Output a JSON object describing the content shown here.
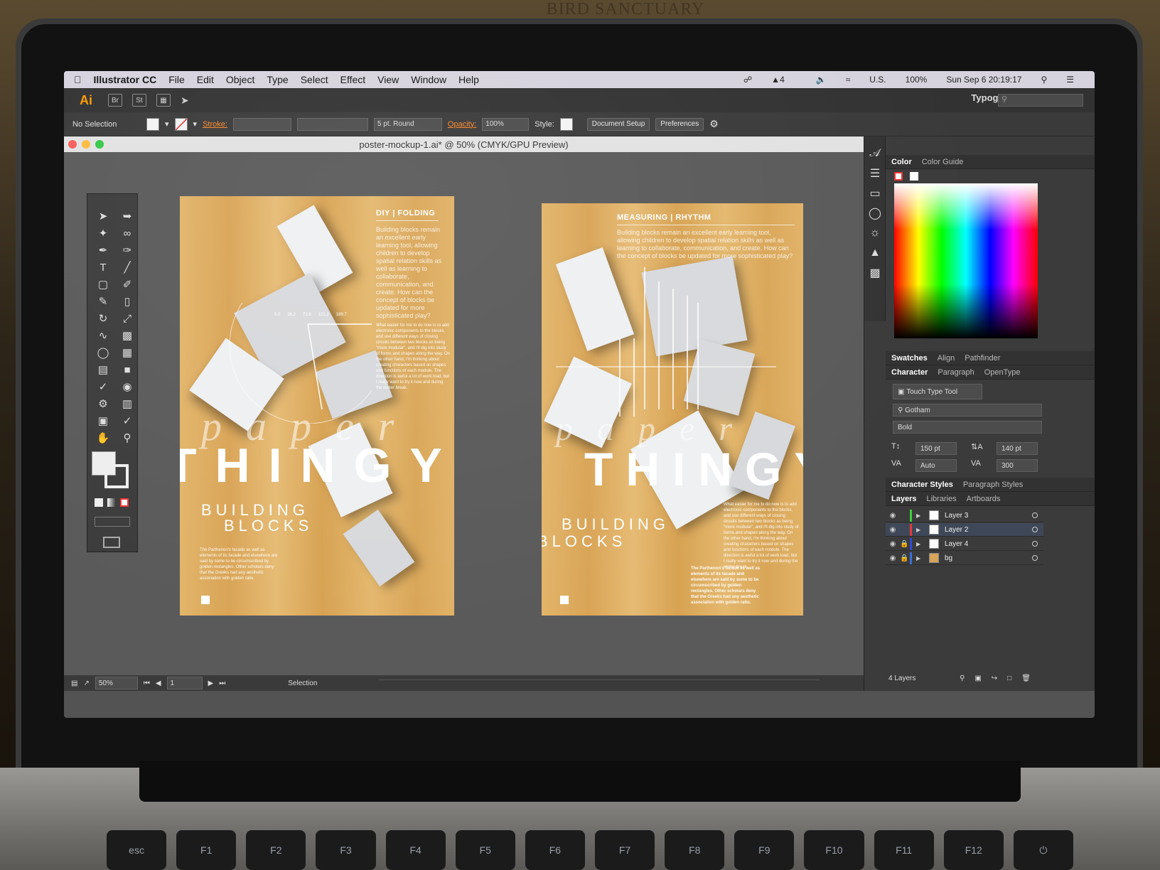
{
  "menubar": {
    "app_name": "Illustrator CC",
    "menus": [
      "File",
      "Edit",
      "Object",
      "Type",
      "Select",
      "Effect",
      "View",
      "Window",
      "Help"
    ],
    "status_icons": [
      "creative-cloud-icon",
      "adobe-icon",
      "volume-icon",
      "wifi-icon",
      "flag-icon"
    ],
    "adobe_count": "4",
    "input_source": "U.S.",
    "battery": "100%",
    "datetime": "Sun Sep 6  20:19:17"
  },
  "appbar": {
    "logo": "Ai",
    "bridge": "Br",
    "stock": "St",
    "workspace": "Typography"
  },
  "control": {
    "selection": "No Selection",
    "stroke_label": "Stroke:",
    "brush": "5 pt. Round",
    "opacity_label": "Opacity:",
    "opacity_value": "100%",
    "style_label": "Style:",
    "document_setup": "Document Setup",
    "preferences": "Preferences"
  },
  "document": {
    "title": "poster-mockup-1.ai* @ 50% (CMYK/GPU Preview)"
  },
  "status": {
    "zoom": "50%",
    "artboard": "1",
    "tool": "Selection"
  },
  "poster1": {
    "header": "DIY | FOLDING",
    "intro": "Building blocks remain an excellent early learning tool, allowing children to develop spatial relation skills as well as learning to collaborate, communication, and create. How can the concept of blocks be updated for more sophisticated play?",
    "scale": [
      "0.0",
      "36.2",
      "72.8",
      "121.2",
      "189.7"
    ],
    "body": "What easier for me to do now is to add electronic components to the blocks, and use different ways of closing circuits between two blocks as being \"more modular\", and I'll dig into study of forms and shapes along the way. On the other hand, I'm thinking about creating characters based on shapes and functions of each module. The direction is awful a lot of work load, but I really want to try it now and during the winter break.",
    "paper": "paper",
    "title": "THINGY",
    "building": "BUILDING",
    "blocks": "BLOCKS",
    "footer": "The Parthenon's facade as well as elements of its facade and elsewhere are said by some to be circumscribed by golden rectangles. Other scholars deny that the Greeks had any aesthetic association with golden ratio."
  },
  "poster2": {
    "header": "MEASURING | RHYTHM",
    "intro": "Building blocks remain an excellent early learning tool, allowing children to develop spatial relation skills as well as learning to collaborate, communication, and create. How can the concept of blocks be updated for more sophisticated play?",
    "paper": "paper",
    "title": "THINGY",
    "building": "BUILDING",
    "blocks": "BLOCKS",
    "body": "What easier for me to do now is to add electronic components to the blocks, and use different ways of closing circuits between two blocks as being \"more modular\", and I'll dig into study of forms and shapes along the way. On the other hand, I'm thinking about creating characters based on shapes and functions of each module. The direction is awful a lot of work load, but I really want to try it now and during the winter break.",
    "footer": "The Parthenon's facade as well as elements of its facade and elsewhere are said by some to be circumscribed by golden rectangles. Other scholars deny that the Greeks had any aesthetic association with golden ratio."
  },
  "panels": {
    "color_tabs": [
      "Color",
      "Color Guide"
    ],
    "swatch_tabs": [
      "Swatches",
      "Align",
      "Pathfinder"
    ],
    "char_tabs": [
      "Character",
      "Paragraph",
      "OpenType"
    ],
    "touch_type": "Touch Type Tool",
    "font_family": "Gotham",
    "font_style": "Bold",
    "font_size": "150 pt",
    "leading": "140 pt",
    "kerning": "Auto",
    "tracking": "300",
    "style_tabs": [
      "Character Styles",
      "Paragraph Styles"
    ],
    "layer_tabs": [
      "Layers",
      "Libraries",
      "Artboards"
    ],
    "layers": [
      {
        "name": "Layer 3",
        "color": "#3ccf3c",
        "locked": false
      },
      {
        "name": "Layer 2",
        "color": "#e33b3b",
        "locked": false
      },
      {
        "name": "Layer 4",
        "color": "#2f49d6",
        "locked": true
      },
      {
        "name": "bg",
        "color": "#3a6fd8",
        "locked": true
      }
    ],
    "layer_count": "4 Layers"
  },
  "keyboard": [
    "esc",
    "F1",
    "F2",
    "F3",
    "F4",
    "F5",
    "F6",
    "F7",
    "F8",
    "F9",
    "F10",
    "F11",
    "F12",
    "⏻"
  ],
  "wall_sign": "BIRD SANCTUARY"
}
